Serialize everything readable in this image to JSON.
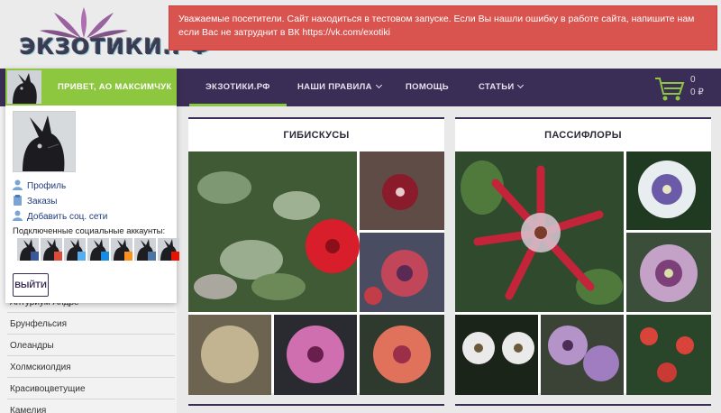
{
  "header": {
    "logo_text": "ЭКЗОТИКИ.РФ",
    "alert_text": "Уважаемые посетители. Сайт находиться в тестовом запуске. Если Вы нашли ошибку в работе сайта, напишите нам если Вас не затруднит в ВК ",
    "alert_link": "https://vk.com/exotiki"
  },
  "nav": {
    "items": [
      {
        "label": "ЭКЗОТИКИ.РФ",
        "active": true
      },
      {
        "label": "НАШИ ПРАВИЛА",
        "dropdown": true
      },
      {
        "label": "ПОМОЩЬ"
      },
      {
        "label": "СТАТЬИ",
        "dropdown": true
      }
    ],
    "cart": {
      "count": "0",
      "sum": "0 ₽",
      "icon": "shopping-cart-icon"
    }
  },
  "user_panel": {
    "greeting": "ПРИВЕТ, АО МАКСИМЧУК",
    "links": [
      {
        "label": "Профиль",
        "icon": "user-icon"
      },
      {
        "label": "Заказы",
        "icon": "orders-icon"
      },
      {
        "label": "Добавить соц. сети",
        "icon": "add-user-icon"
      }
    ],
    "social_label": "Подключенные социальные аккаунты:",
    "social_accounts": [
      "facebook",
      "google",
      "twitter",
      "mail",
      "odnoklassniki",
      "vk",
      "yandex"
    ],
    "logout_label": "ВЫЙТИ"
  },
  "sidebar": {
    "items": [
      "Антуриум Андре",
      "Брунфельсия",
      "Олеандры",
      "Холмскиолдия",
      "Красивоцветущие",
      "Камелия"
    ]
  },
  "cards": [
    {
      "title": "ГИБИСКУСЫ"
    },
    {
      "title": "ПАССИФЛОРЫ"
    }
  ],
  "colors": {
    "nav_bg": "#3b2e56",
    "accent_green": "#8dc63f",
    "alert_red": "#d9534f"
  }
}
